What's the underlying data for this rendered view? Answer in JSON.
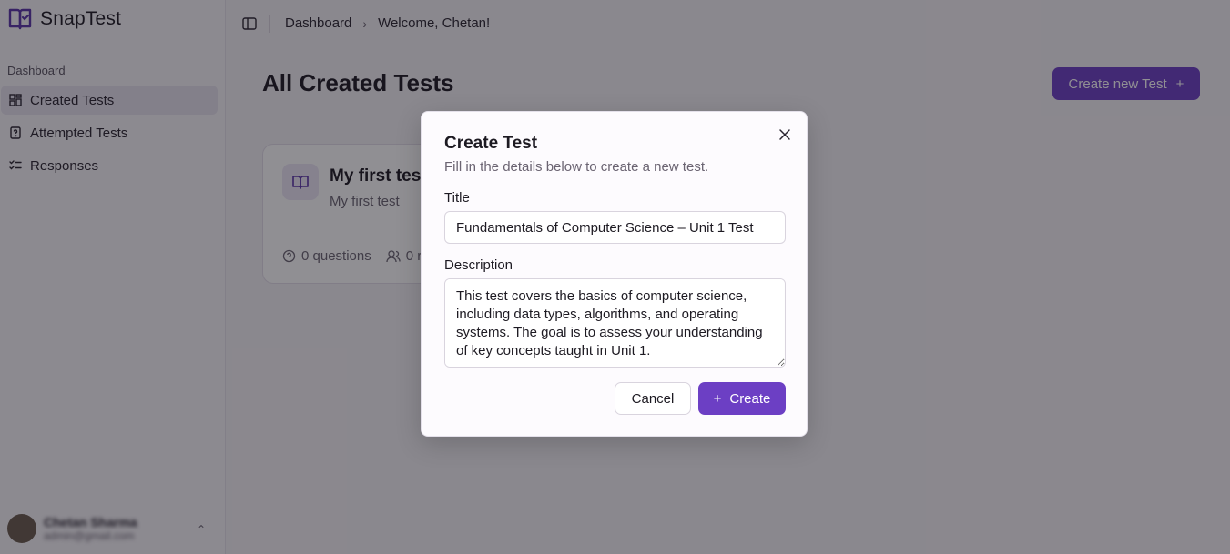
{
  "app": {
    "name": "SnapTest"
  },
  "sidebar": {
    "section_label": "Dashboard",
    "items": [
      {
        "label": "Created Tests",
        "icon": "grid-icon",
        "active": true
      },
      {
        "label": "Attempted Tests",
        "icon": "file-question-icon",
        "active": false
      },
      {
        "label": "Responses",
        "icon": "list-checks-icon",
        "active": false
      }
    ],
    "user": {
      "name": "Chetan Sharma",
      "email": "admin@gmail.com"
    }
  },
  "breadcrumb": {
    "root": "Dashboard",
    "current": "Welcome, Chetan!"
  },
  "main": {
    "title": "All Created Tests",
    "create_button_label": "Create new Test",
    "cards": [
      {
        "title": "My first test",
        "subtitle": "My first test",
        "questions": "0 questions",
        "responses": "0 r"
      }
    ]
  },
  "dialog": {
    "title": "Create Test",
    "description": "Fill in the details below to create a new test.",
    "title_label": "Title",
    "title_value": "Fundamentals of Computer Science – Unit 1 Test",
    "description_label": "Description",
    "description_value": "This test covers the basics of computer science, including data types, algorithms, and operating systems. The goal is to assess your understanding of key concepts taught in Unit 1.",
    "cancel_label": "Cancel",
    "create_label": "Create"
  },
  "colors": {
    "accent": "#6c3fc4",
    "overlay": "rgba(20,16,26,0.47)"
  }
}
